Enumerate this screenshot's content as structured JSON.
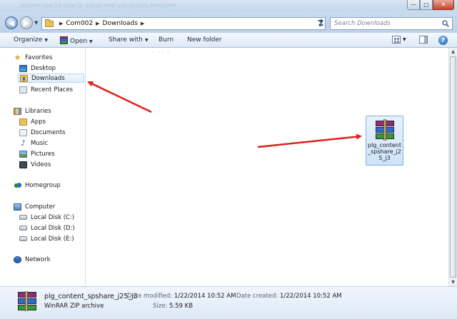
{
  "window": {
    "ghost_title": "...knowledge/14-how-to-install-and-use-joomla-template",
    "controls": {
      "minimize": "—",
      "maximize": "□",
      "close": "✕"
    }
  },
  "address": {
    "crumbs": [
      "Com002",
      "Downloads"
    ],
    "search_placeholder": "Search Downloads"
  },
  "toolbar": {
    "organize": "Organize",
    "open": "Open",
    "share_with": "Share with",
    "burn": "Burn",
    "new_folder": "New folder"
  },
  "nav": {
    "favorites": "Favorites",
    "desktop": "Desktop",
    "downloads": "Downloads",
    "recent_places": "Recent Places",
    "libraries": "Libraries",
    "apps": "Apps",
    "documents": "Documents",
    "music": "Music",
    "pictures": "Pictures",
    "videos": "Videos",
    "homegroup": "Homegroup",
    "computer": "Computer",
    "local_c": "Local Disk (C:)",
    "local_d": "Local Disk (D:)",
    "local_e": "Local Disk (E:)",
    "network": "Network"
  },
  "file": {
    "label": "plg_content_spshare_j25_j3"
  },
  "details": {
    "name": "plg_content_spshare_j25_j3",
    "type": "WinRAR ZIP archive",
    "date_modified_label": "Date modified:",
    "date_modified": "1/22/2014 10:52 AM",
    "date_created_label": "Date created:",
    "date_created": "1/22/2014 10:52 AM",
    "size_label": "Size:",
    "size": "5.59 KB"
  },
  "colors": {
    "annotation_arrow": "#e0201b",
    "selection": "#cde3fb"
  }
}
